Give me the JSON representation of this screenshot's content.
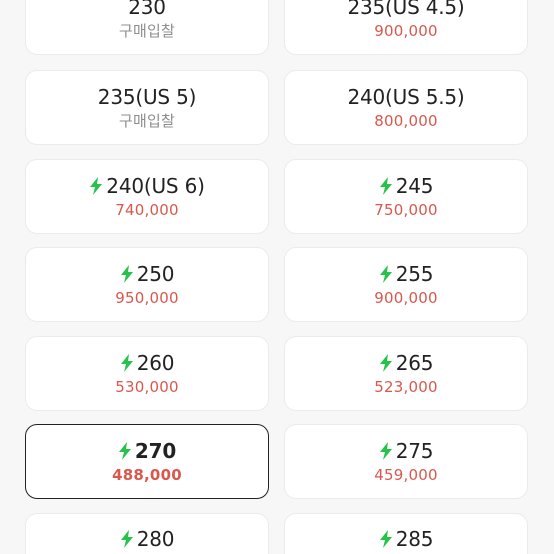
{
  "colors": {
    "price": "#d9584d",
    "bid_text": "#8e8e8e",
    "bolt": "#27c24c",
    "selected_border": "#222222"
  },
  "sizes": [
    {
      "size": "230",
      "price": "구매입찰",
      "fast": false,
      "has_price": false
    },
    {
      "size": "235(US 4.5)",
      "price": "900,000",
      "fast": false,
      "has_price": true
    },
    {
      "size": "235(US 5)",
      "price": "구매입찰",
      "fast": false,
      "has_price": false
    },
    {
      "size": "240(US 5.5)",
      "price": "800,000",
      "fast": false,
      "has_price": true
    },
    {
      "size": "240(US 6)",
      "price": "740,000",
      "fast": true,
      "has_price": true
    },
    {
      "size": "245",
      "price": "750,000",
      "fast": true,
      "has_price": true
    },
    {
      "size": "250",
      "price": "950,000",
      "fast": true,
      "has_price": true
    },
    {
      "size": "255",
      "price": "900,000",
      "fast": true,
      "has_price": true
    },
    {
      "size": "260",
      "price": "530,000",
      "fast": true,
      "has_price": true
    },
    {
      "size": "265",
      "price": "523,000",
      "fast": true,
      "has_price": true
    },
    {
      "size": "270",
      "price": "488,000",
      "fast": true,
      "has_price": true,
      "selected": true
    },
    {
      "size": "275",
      "price": "459,000",
      "fast": true,
      "has_price": true
    },
    {
      "size": "280",
      "price": "",
      "fast": true,
      "has_price": true
    },
    {
      "size": "285",
      "price": "",
      "fast": true,
      "has_price": true
    }
  ]
}
